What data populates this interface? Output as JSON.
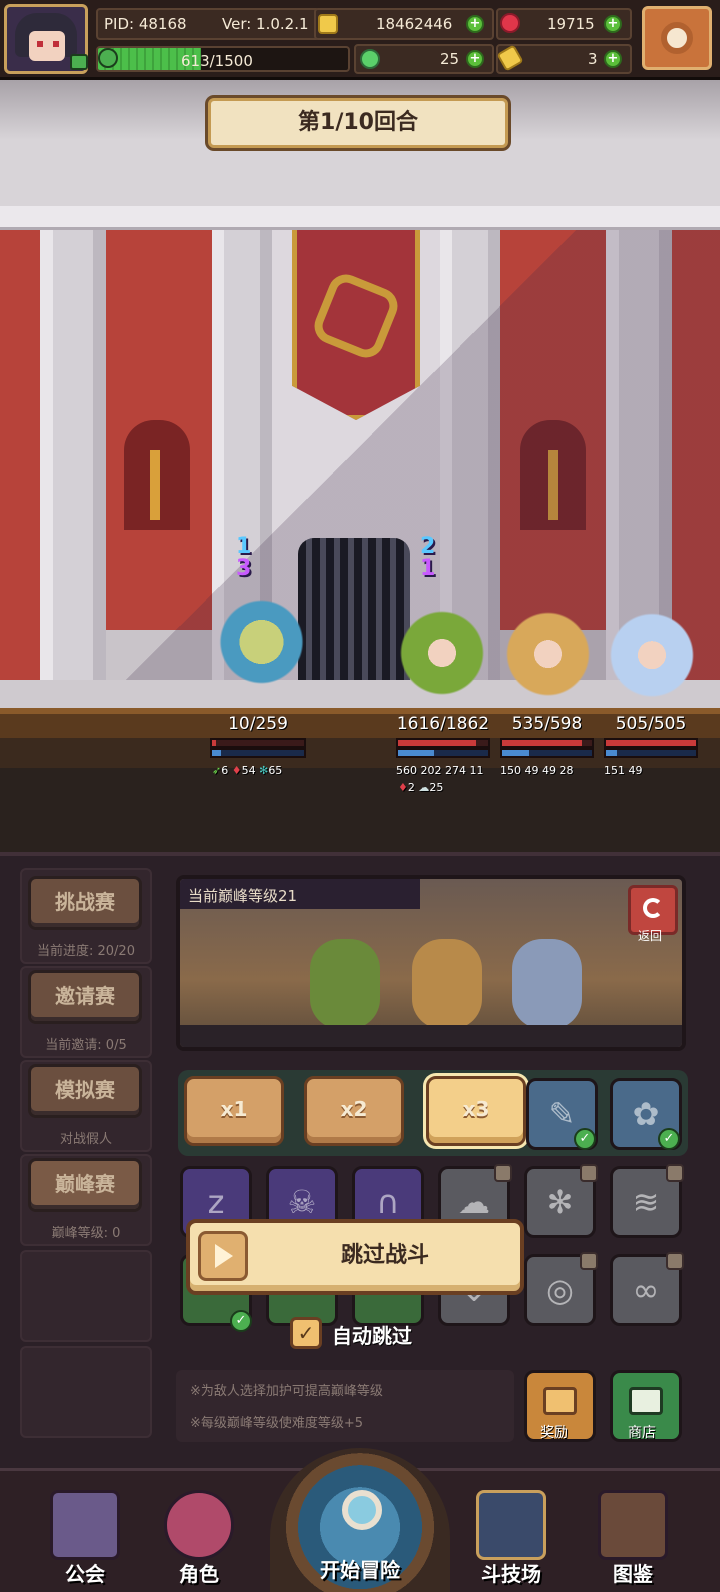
{
  "header": {
    "pid": "PID: 48168",
    "version": "Ver: 1.0.2.1",
    "gold": "18462446",
    "gems": "19715",
    "exp": "613/1500",
    "exp_progress": 0.41,
    "clovers": "25",
    "tickets": "3"
  },
  "battle": {
    "round": "第1/10回合",
    "heroes": [
      {
        "hp": "10/259",
        "hp_fraction": 0.04,
        "stats": [
          "6",
          "54",
          "65"
        ],
        "buff_top": "1",
        "buff_bottom": "3"
      },
      {
        "hp": "1616/1862",
        "hp_fraction": 0.87,
        "stats": [
          "560",
          "202",
          "274",
          "11"
        ],
        "stats2": [
          "2",
          "25"
        ],
        "buff_top": "2",
        "buff_bottom": "1"
      },
      {
        "hp": "535/598",
        "hp_fraction": 0.89,
        "stats": [
          "150",
          "49",
          "49",
          "28"
        ]
      },
      {
        "hp": "505/505",
        "hp_fraction": 1.0,
        "stats": [
          "151",
          "49"
        ]
      }
    ]
  },
  "sidebar": {
    "items": [
      {
        "label": "挑战赛",
        "sub": "当前进度: 20/20"
      },
      {
        "label": "邀请赛",
        "sub": "当前邀请: 0/5"
      },
      {
        "label": "模拟赛",
        "sub": "对战假人"
      },
      {
        "label": "巅峰赛",
        "sub": "巅峰等级: 0"
      }
    ]
  },
  "preview": {
    "title": "当前巅峰等级21",
    "back_label": "返回"
  },
  "speed": [
    "x1",
    "x2",
    "x3"
  ],
  "skip_label": "跳过战斗",
  "auto_skip_label": "自动跳过",
  "notes": [
    "※为敌人选择加护可提高巅峰等级",
    "※每级巅峰等级使难度等级+5"
  ],
  "side_buttons": {
    "reward": "奖励",
    "shop": "商店"
  },
  "nav": {
    "guild": "公会",
    "character": "角色",
    "adventure": "开始冒险",
    "arena": "斗技场",
    "codex": "图鉴"
  },
  "colors": {
    "hp_red": "#c93a3a",
    "mana_blue": "#4a8ad0",
    "accent_gold": "#c49a52"
  }
}
